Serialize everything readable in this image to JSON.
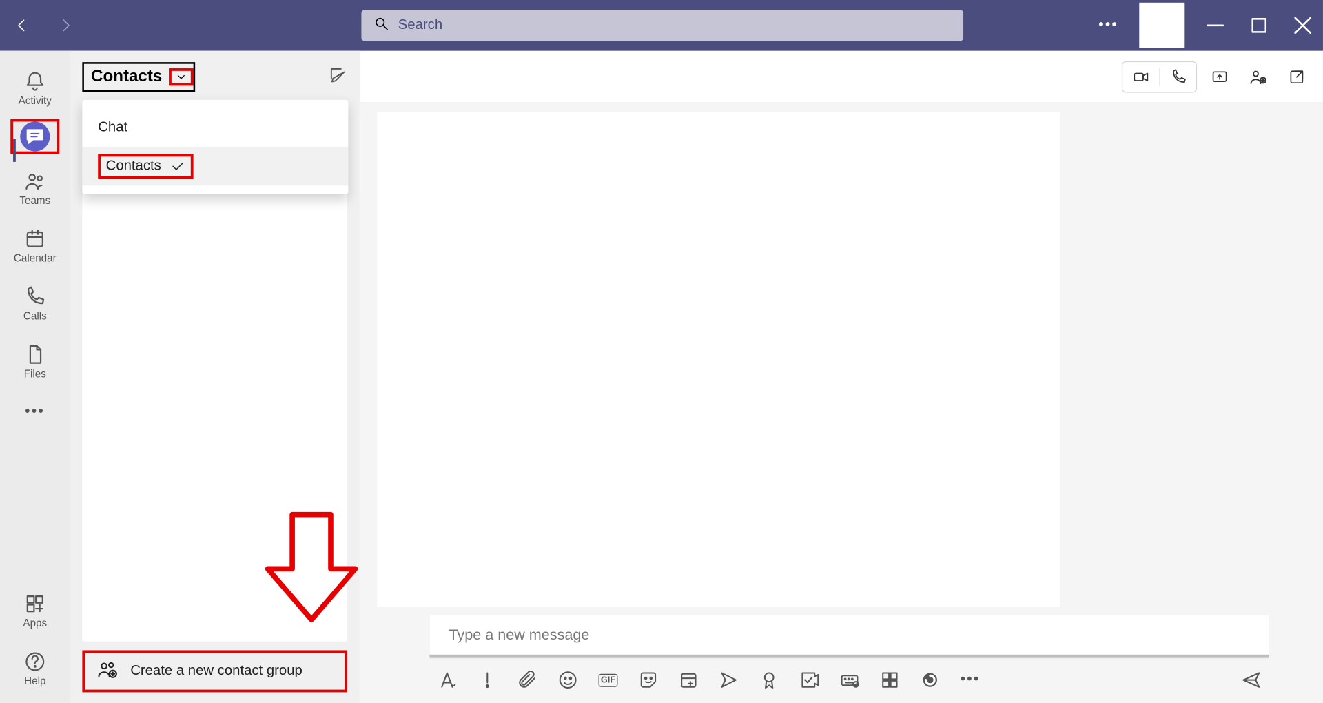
{
  "titlebar": {
    "search_placeholder": "Search"
  },
  "rail": {
    "items": [
      {
        "label": "Activity"
      },
      {
        "label": "Chat"
      },
      {
        "label": "Teams"
      },
      {
        "label": "Calendar"
      },
      {
        "label": "Calls"
      },
      {
        "label": "Files"
      }
    ],
    "apps_label": "Apps",
    "help_label": "Help"
  },
  "listpanel": {
    "filter_label": "Contacts",
    "dropdown": {
      "option_chat": "Chat",
      "option_contacts": "Contacts"
    },
    "create_group_label": "Create a new contact group"
  },
  "composer": {
    "placeholder": "Type a new message"
  }
}
